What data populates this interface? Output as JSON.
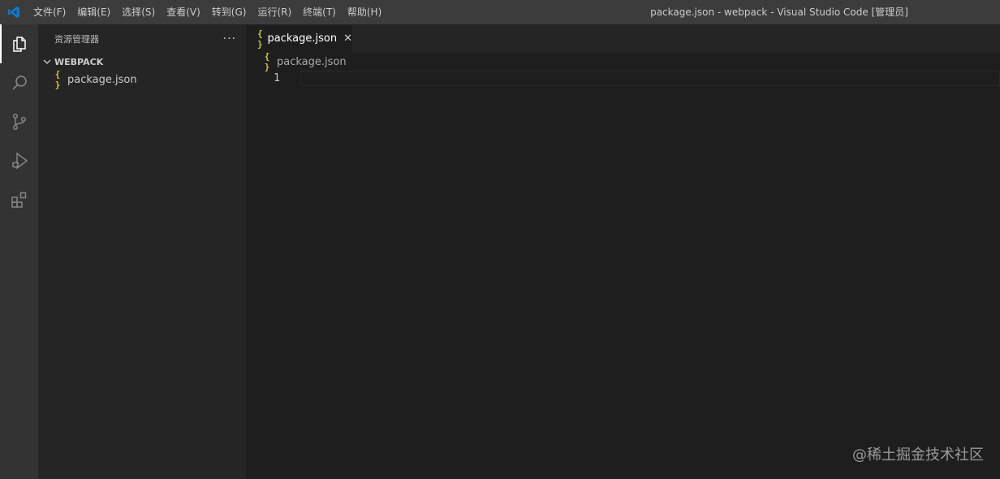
{
  "titlebar": {
    "menu": [
      "文件(F)",
      "编辑(E)",
      "选择(S)",
      "查看(V)",
      "转到(G)",
      "运行(R)",
      "终端(T)",
      "帮助(H)"
    ],
    "window_title": "package.json - webpack - Visual Studio Code [管理员]"
  },
  "activitybar": {
    "items": [
      "explorer-icon",
      "search-icon",
      "source-control-icon",
      "run-debug-icon",
      "extensions-icon"
    ],
    "active": "explorer-icon"
  },
  "sidebar": {
    "title": "资源管理器",
    "more_glyph": "···",
    "section": "WEBPACK",
    "files": [
      {
        "name": "package.json",
        "glyph": "{ }",
        "icon": "json-file-icon"
      }
    ]
  },
  "editor": {
    "tab": {
      "label": "package.json",
      "glyph": "{ }",
      "close_glyph": "✕"
    },
    "breadcrumb": {
      "label": "package.json",
      "glyph": "{ }"
    },
    "lines": [
      "1"
    ]
  },
  "watermark": "@稀土掘金技术社区",
  "colors": {
    "titlebar": "#3c3c3c",
    "activitybar": "#333333",
    "sidebar": "#252526",
    "editor": "#1e1e1e",
    "vscode_blue": "#0e7ad1",
    "json_yellow": "#cbcb41"
  }
}
